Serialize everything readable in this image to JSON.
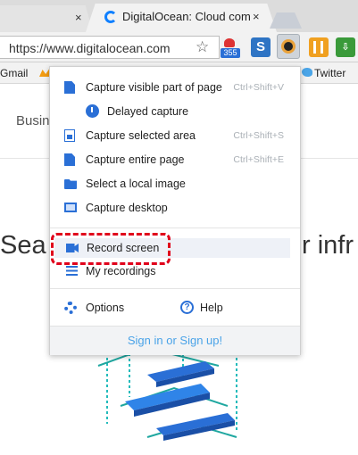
{
  "browser": {
    "active_tab_title": "DigitalOcean: Cloud com",
    "tab_close_glyph": "×",
    "url": "https://www.digitalocean.com",
    "extension_badge_count": "355",
    "extensions": [
      "red-extension-icon",
      "s-extension-icon",
      "screenshot-camera-icon",
      "fork-extension-icon",
      "pdf-extension-icon"
    ]
  },
  "bookmarks": [
    {
      "label": "Gmail"
    },
    {
      "label": "Twitter"
    }
  ],
  "page": {
    "nav_text": "Busin",
    "hero_left": "Sea",
    "hero_right": "r infr"
  },
  "menu": {
    "items": [
      {
        "label": "Capture visible part of page",
        "shortcut": "Ctrl+Shift+V",
        "icon": "document-icon"
      },
      {
        "label": "Delayed capture",
        "shortcut": "",
        "icon": "timer-icon"
      },
      {
        "label": "Capture selected area",
        "shortcut": "Ctrl+Shift+S",
        "icon": "selection-icon"
      },
      {
        "label": "Capture entire page",
        "shortcut": "Ctrl+Shift+E",
        "icon": "document-icon"
      },
      {
        "label": "Select a local image",
        "shortcut": "",
        "icon": "folder-icon"
      },
      {
        "label": "Capture desktop",
        "shortcut": "",
        "icon": "monitor-icon"
      },
      {
        "label": "Record screen",
        "shortcut": "",
        "icon": "video-camera-icon"
      },
      {
        "label": "My recordings",
        "shortcut": "",
        "icon": "list-icon"
      }
    ],
    "options_label": "Options",
    "help_label": "Help",
    "help_glyph": "?",
    "signin_label": "Sign in or Sign up!"
  },
  "colors": {
    "accent": "#2a6fd6",
    "annotation": "#e0001b",
    "link": "#4aa3e8"
  }
}
